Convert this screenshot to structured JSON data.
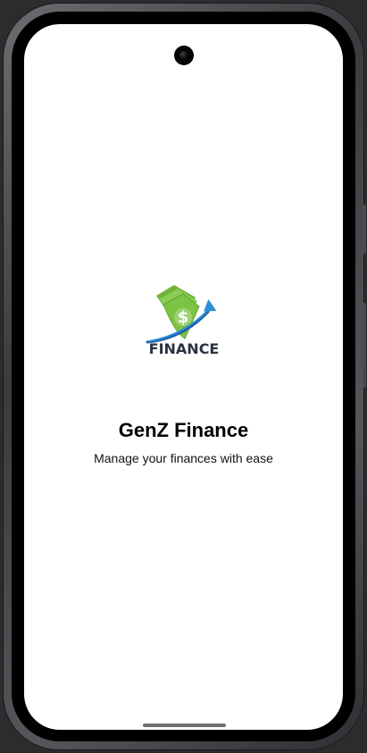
{
  "app": {
    "logo": {
      "icon": "money-bills-growth-icon",
      "word": "FINANCE",
      "colors": {
        "bill_green": "#7cc245",
        "bill_dark_green": "#4e9a2a",
        "arrow_blue": "#2f8fd6",
        "text_dark": "#2a3442"
      }
    },
    "title": "GenZ Finance",
    "subtitle": "Manage your finances with ease"
  }
}
